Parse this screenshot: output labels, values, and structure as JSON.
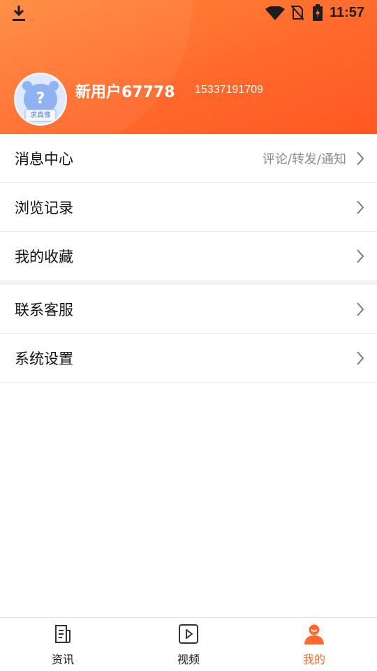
{
  "status_bar": {
    "time": "11:57"
  },
  "profile": {
    "username": "新用户67778",
    "phone": "15337191709",
    "avatar_text": "求真像"
  },
  "menu": {
    "section1": [
      {
        "label": "消息中心",
        "hint": "评论/转发/通知"
      },
      {
        "label": "浏览记录"
      },
      {
        "label": "我的收藏"
      }
    ],
    "section2": [
      {
        "label": "联系客服"
      },
      {
        "label": "系统设置"
      }
    ]
  },
  "tabbar": {
    "items": [
      {
        "label": "资讯",
        "icon": "document-icon"
      },
      {
        "label": "视频",
        "icon": "play-icon"
      },
      {
        "label": "我的",
        "icon": "user-icon"
      }
    ],
    "active_index": 2
  },
  "colors": {
    "accent": "#ff6a2c",
    "header_start": "#ff8a3d",
    "header_end": "#ff5722"
  }
}
